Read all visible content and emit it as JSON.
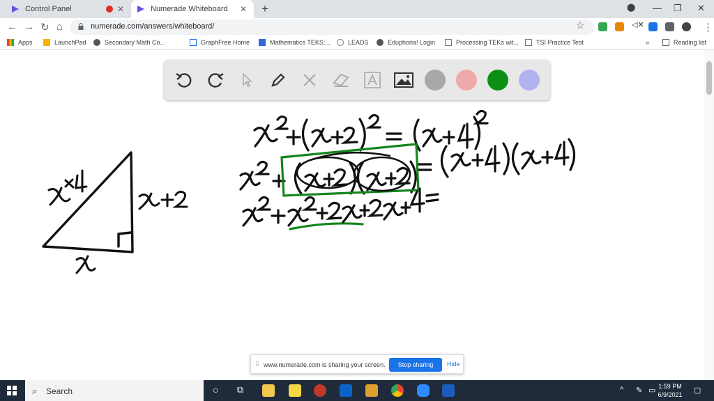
{
  "browser": {
    "tabs": [
      {
        "label": "Control Panel"
      },
      {
        "label": "Numerade Whiteboard"
      }
    ],
    "url": "numerade.com/answers/whiteboard/",
    "bookmarks": [
      {
        "label": "Apps"
      },
      {
        "label": "LaunchPad"
      },
      {
        "label": "Secondary Math Co..."
      },
      {
        "label": "GraphFree Home"
      },
      {
        "label": "Mathematics TEKS:..."
      },
      {
        "label": "LEADS"
      },
      {
        "label": "Eduphoria! Login"
      },
      {
        "label": "Processing TEKs wit..."
      },
      {
        "label": "TSI Practice Test"
      }
    ],
    "reading_list": "Reading list"
  },
  "whiteboard": {
    "tools": [
      "undo-icon",
      "redo-icon",
      "pointer-icon",
      "pen-icon",
      "tools-icon",
      "eraser-icon",
      "text-icon",
      "image-icon"
    ],
    "colors": [
      "#a8a8a8",
      "#eeaaaa",
      "#0c8f14",
      "#b0b4ef"
    ],
    "ink_color": "#111111",
    "highlight_color": "#13861c",
    "triangle_labels": {
      "hypotenuse": "x+4",
      "vertical_leg": "x+2",
      "base": "x"
    },
    "equations": [
      "x² + (x+2)² = (x+4)²",
      "x² + (x+2)(x+2) = (x+4)(x+4)",
      "x² + x² + 2x + 2x + 4 ="
    ]
  },
  "share_bar": {
    "message": "www.numerade.com is sharing your screen.",
    "stop_label": "Stop sharing",
    "hide_label": "Hide"
  },
  "taskbar": {
    "search_placeholder": "Search",
    "time": "1:59 PM",
    "date": "6/9/2021"
  }
}
